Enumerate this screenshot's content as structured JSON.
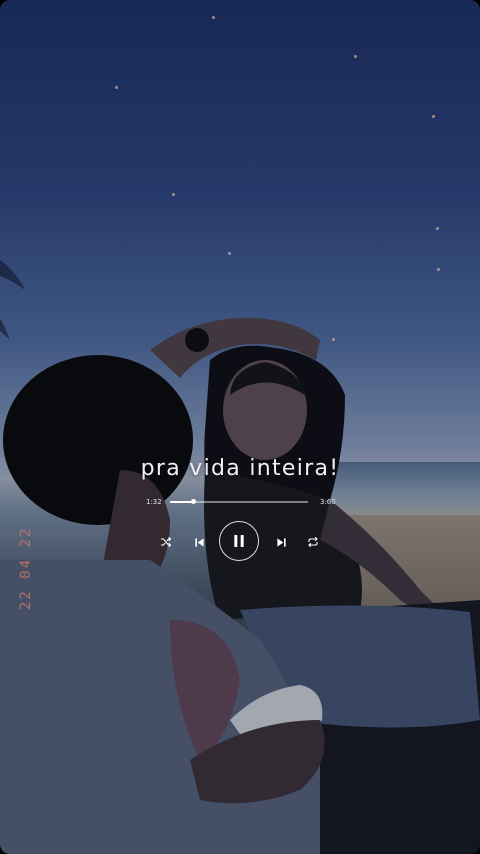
{
  "song": {
    "title": "pra vida inteira!",
    "elapsed": "1:32",
    "total": "3:60",
    "progress": 0.17
  },
  "date_stamp": "22 04 22",
  "controls": {
    "shuffle_icon": "shuffle-icon",
    "prev_icon": "skip-previous-icon",
    "play_icon": "pause-icon",
    "next_icon": "skip-next-icon",
    "repeat_icon": "repeat-icon"
  },
  "colors": {
    "text": "#f1f1f3",
    "date_stamp": "#d57b63"
  }
}
